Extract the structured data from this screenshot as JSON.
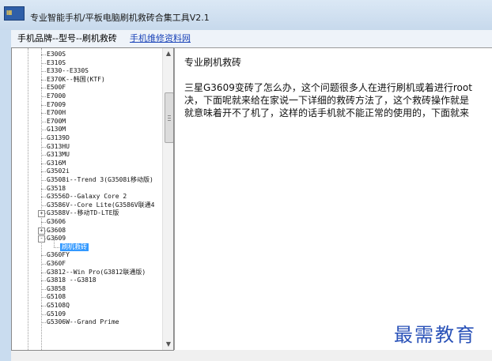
{
  "window": {
    "title": "专业智能手机/平板电脑刷机救砖合集工具V2.1",
    "icon": "app-icon"
  },
  "menu": {
    "items": [
      "手机品牌--型号--刷机救砖",
      "手机维修资料网"
    ]
  },
  "tree": {
    "rows": [
      {
        "text": "E300S"
      },
      {
        "text": "E310S"
      },
      {
        "text": "E330--E330S"
      },
      {
        "text": "E370K--韩国(KTF)"
      },
      {
        "text": "E500F"
      },
      {
        "text": "E7000"
      },
      {
        "text": "E7009"
      },
      {
        "text": "E700H"
      },
      {
        "text": "E700M"
      },
      {
        "text": "G130M"
      },
      {
        "text": "G3139D"
      },
      {
        "text": "G313HU"
      },
      {
        "text": "G313MU"
      },
      {
        "text": "G316M"
      },
      {
        "text": "G3502i"
      },
      {
        "text": "G3508i--Trend 3(G3508i移动版)"
      },
      {
        "text": "G3518"
      },
      {
        "text": "G3556D--Galaxy Core 2"
      },
      {
        "text": "G3586V--Core Lite(G3586V联通4"
      },
      {
        "text": "G3588V--移动TD-LTE版",
        "expander": "+"
      },
      {
        "text": "G3606"
      },
      {
        "text": "G3608",
        "expander": "+"
      },
      {
        "text": "G3609",
        "expander": "-"
      },
      {
        "text": "刷机救砖",
        "child": true,
        "selected": true
      },
      {
        "text": "G360FY"
      },
      {
        "text": "G360F"
      },
      {
        "text": "G3812--Win Pro(G3812联通版)"
      },
      {
        "text": "G3818 --G3818"
      },
      {
        "text": "G3858"
      },
      {
        "text": "G5108"
      },
      {
        "text": "G5108Q"
      },
      {
        "text": "G5109"
      },
      {
        "text": "G5306W--Grand Prime"
      }
    ]
  },
  "content": {
    "title": "专业刷机救砖",
    "lines": [
      "三星G3609变砖了怎么办，这个问题很多人在进行刷机或着进行root",
      "决，下面呢就来给在家说一下详细的救砖方法了，这个救砖操作就是",
      "就意味着开不了机了，这样的话手机就不能正常的使用的，下面就来"
    ]
  },
  "watermark": "最需教育"
}
